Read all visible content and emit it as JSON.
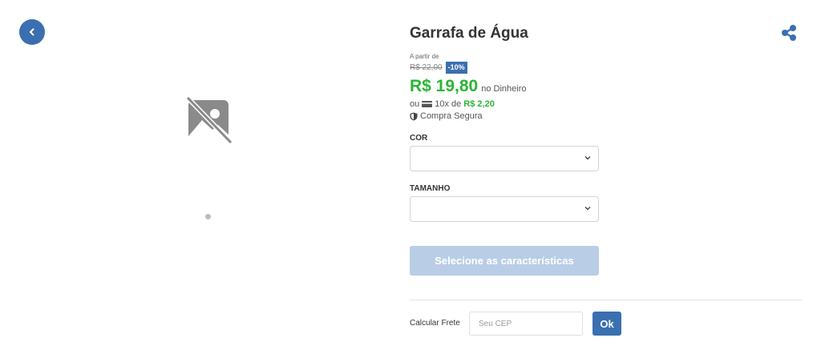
{
  "product": {
    "title": "Garrafa de Água",
    "from_label": "A partir de",
    "old_price": "R$ 22,00",
    "discount_badge": "-10%",
    "price": "R$ 19,80",
    "price_note": "no Dinheiro",
    "installments_prefix": "ou",
    "installments_text": "10x de",
    "installment_value": "R$ 2,20",
    "secure_label": "Compra Segura"
  },
  "options": {
    "color_label": "COR",
    "color_value": "",
    "size_label": "TAMANHO",
    "size_value": ""
  },
  "cta": {
    "label": "Selecione as características"
  },
  "shipping": {
    "label": "Calcular Frete",
    "placeholder": "Seu CEP",
    "button_label": "Ok"
  },
  "icons": {
    "back": "chevron-left-icon",
    "share": "share-icon",
    "image_placeholder": "no-image-icon",
    "card": "credit-card-icon",
    "secure": "shield-icon"
  },
  "colors": {
    "accent": "#3a6fb0",
    "price_green": "#2bb534",
    "cta_disabled": "#b9cde6"
  }
}
